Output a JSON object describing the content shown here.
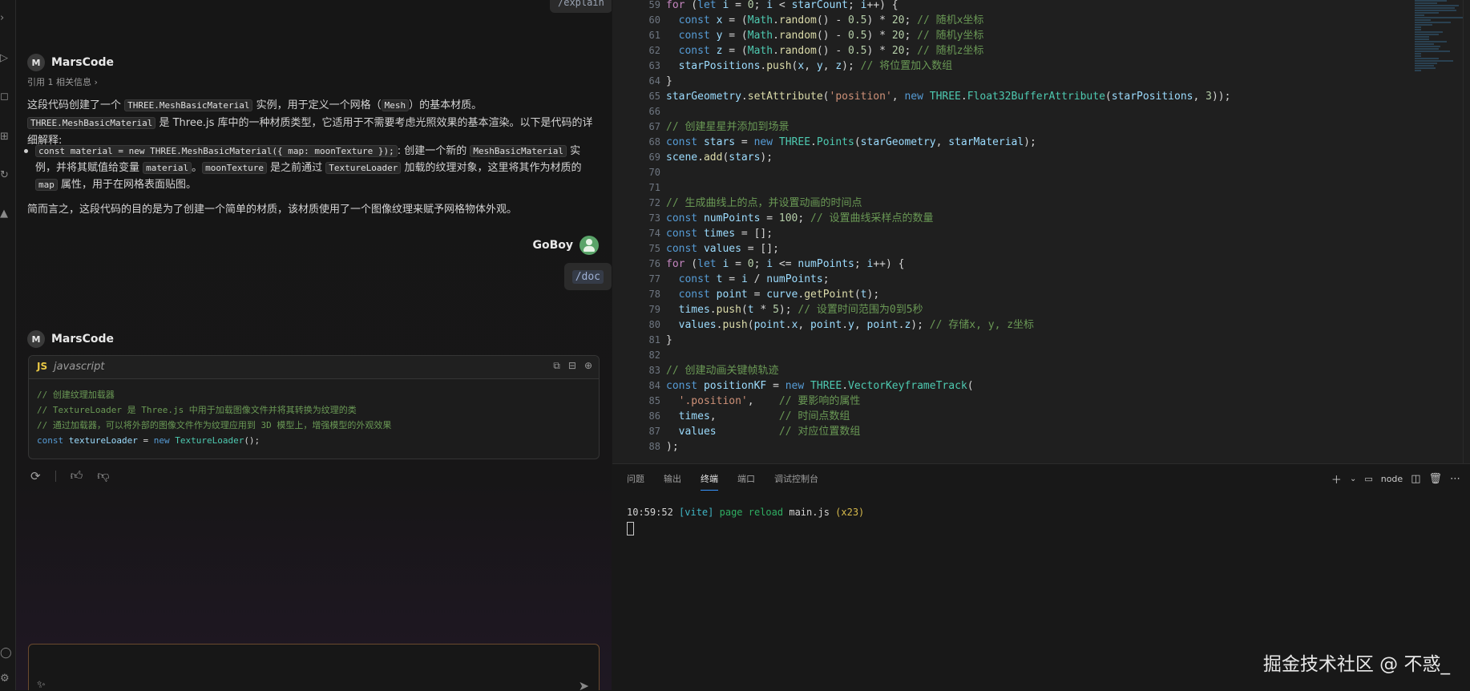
{
  "chat": {
    "prev_command": "/explain",
    "bot_name": "MarsCode",
    "reference": "引用 1 相关信息 ›",
    "response": {
      "p1_a": "这段代码创建了一个 ",
      "p1_code1": "THREE.MeshBasicMaterial",
      "p1_b": " 实例，用于定义一个网格（",
      "p1_code2": "Mesh",
      "p1_c": "）的基本材质。",
      "p1_code3": "THREE.MeshBasicMaterial",
      "p1_d": " 是 Three.js 库中的一种材质类型，它适用于不需要考虑光照效果的基本渲染。以下是代码的详细解释:",
      "b_code1": "const material = new THREE.MeshBasicMaterial({ map: moonTexture });",
      "b_a": ": 创建一个新的 ",
      "b_code2": "MeshBasicMaterial",
      "b_b": " 实例，并将其赋值给变量 ",
      "b_code3": "material",
      "b_c": "。",
      "b_code4": "moonTexture",
      "b_d": " 是之前通过 ",
      "b_code5": "TextureLoader",
      "b_e": " 加载的纹理对象，这里将其作为材质的 ",
      "b_code6": "map",
      "b_f": " 属性，用于在网格表面贴图。",
      "summary": "简而言之，这段代码的目的是为了创建一个简单的材质，该材质使用了一个图像纹理来赋予网格物体外观。"
    },
    "user_name": "GoBoy",
    "user_command": "/doc",
    "code_block": {
      "badge": "JS",
      "lang": "javascript",
      "c1": "// 创建纹理加载器",
      "c2": "// TextureLoader 是 Three.js 中用于加载图像文件并将其转换为纹理的类",
      "c3": "// 通过加载器，可以将外部的图像文件作为纹理应用到 3D 模型上，增强模型的外观效果",
      "l4_kw": "const",
      "l4_var": "textureLoader",
      "l4_eq": " = ",
      "l4_new": "new",
      "l4_cls": "TextureLoader",
      "l4_end": "();"
    }
  },
  "editor": {
    "line_numbers": [
      "59",
      "60",
      "61",
      "62",
      "63",
      "64",
      "65",
      "66",
      "67",
      "68",
      "69",
      "70",
      "71",
      "72",
      "73",
      "74",
      "75",
      "76",
      "77",
      "78",
      "79",
      "80",
      "81",
      "82",
      "83",
      "84",
      "85",
      "86",
      "87",
      "88"
    ],
    "c60": "// 随机x坐标",
    "c61": "// 随机y坐标",
    "c62": "// 随机z坐标",
    "c63": "// 将位置加入数组",
    "c67": "// 创建星星并添加到场景",
    "c72": "// 生成曲线上的点，并设置动画的时间点",
    "c73": "// 设置曲线采样点的数量",
    "c79": "// 设置时间范围为0到5秒",
    "c80": "// 存储x, y, z坐标",
    "c83": "// 创建动画关键帧轨迹",
    "c85": "// 要影响的属性",
    "c86": "// 时间点数组",
    "c87": "// 对应位置数组"
  },
  "panel": {
    "tabs": [
      "问题",
      "输出",
      "终端",
      "端口",
      "调试控制台"
    ],
    "active_tab": "终端",
    "terminal_label": "node",
    "term_time": "10:59:52",
    "term_tag": "[vite]",
    "term_msg": "page reload",
    "term_file": "main.js",
    "term_count": "(x23)"
  },
  "watermark": "掘金技术社区 @ 不惑_",
  "colors": {
    "accent": "#3794ff",
    "comment": "#6a9955",
    "keyword": "#569cd6",
    "variable": "#9cdcfe",
    "function": "#dcdcaa",
    "class": "#4ec9b0",
    "string": "#ce9178",
    "number": "#b5cea8"
  }
}
